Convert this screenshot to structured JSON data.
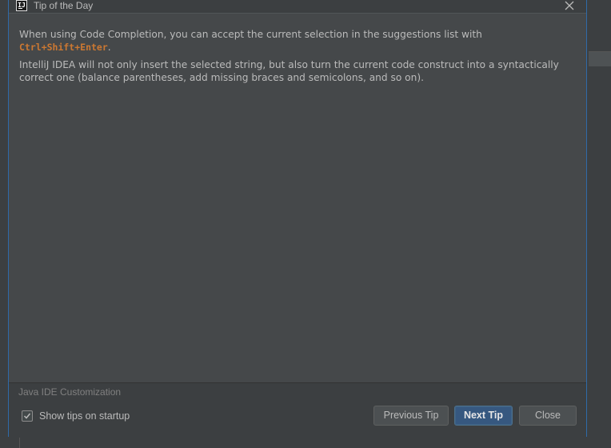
{
  "window": {
    "title": "Tip of the Day",
    "app_icon_text": "IJ"
  },
  "tip": {
    "line1_prefix": "When using Code Completion, you can accept the current selection in the suggestions list with",
    "shortcut": "Ctrl+Shift+Enter",
    "line1_suffix": ".",
    "paragraph2": "IntelliJ IDEA will not only insert the selected string, but also turn the current code construct into a syntactically correct one (balance parentheses, add missing braces and semicolons, and so on)."
  },
  "footer": {
    "category": "Java IDE Customization",
    "show_tips_label": "Show tips on startup",
    "show_tips_checked": true
  },
  "buttons": {
    "previous": "Previous Tip",
    "next": "Next Tip",
    "close": "Close"
  },
  "colors": {
    "accent": "#365880",
    "shortcut": "#cc7832",
    "text": "#bbbbbb"
  },
  "icons": {
    "close": "close-icon",
    "checkbox": "checkmark-icon",
    "app": "intellij-idea-icon"
  }
}
